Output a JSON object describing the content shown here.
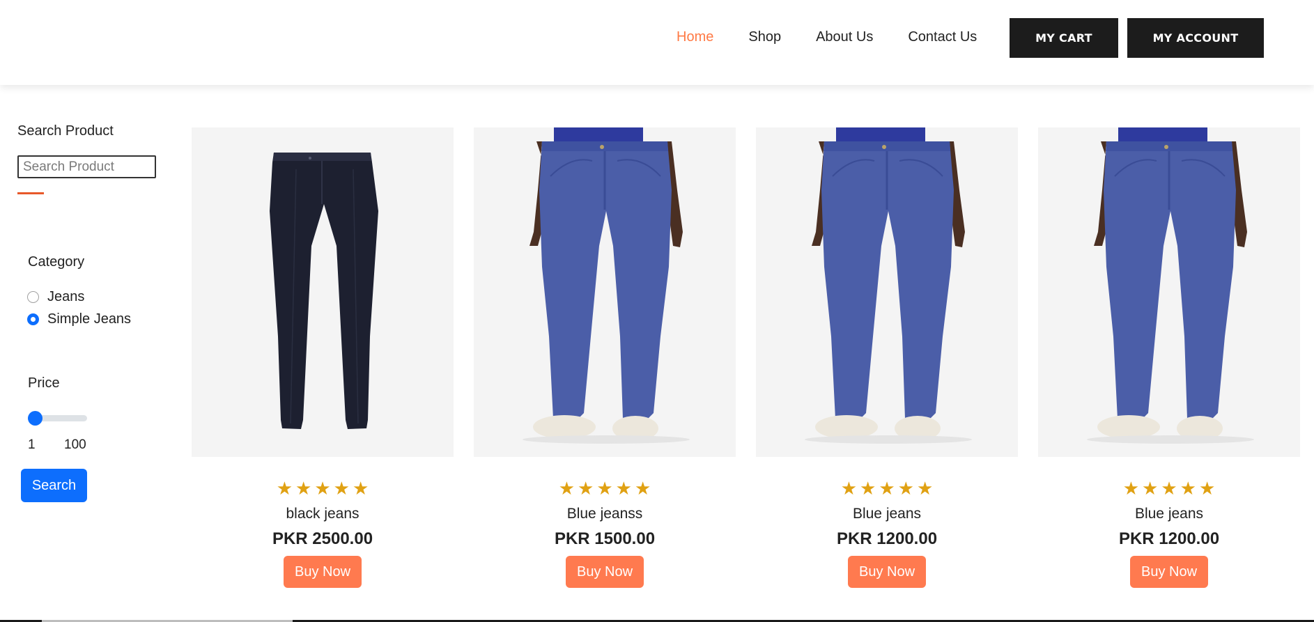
{
  "nav": {
    "items": [
      {
        "label": "Home",
        "active": true
      },
      {
        "label": "Shop",
        "active": false
      },
      {
        "label": "About Us",
        "active": false
      },
      {
        "label": "Contact Us",
        "active": false
      }
    ],
    "cart_label": "MY CART",
    "account_label": "MY ACCOUNT"
  },
  "sidebar": {
    "search_title": "Search Product",
    "search_placeholder": "Search Product",
    "search_value": "",
    "category_title": "Category",
    "categories": [
      {
        "label": "Jeans",
        "checked": false
      },
      {
        "label": "Simple Jeans",
        "checked": true
      }
    ],
    "price_title": "Price",
    "price_min": "1",
    "price_max": "100",
    "price_value_fraction": 0.0,
    "search_button": "Search"
  },
  "products": [
    {
      "name": "black jeans",
      "price": "PKR 2500.00",
      "rating": 5,
      "buy_label": "Buy Now",
      "image": "black-trousers"
    },
    {
      "name": "Blue jeanss",
      "price": "PKR 1500.00",
      "rating": 5,
      "buy_label": "Buy Now",
      "image": "blue-jeans-model"
    },
    {
      "name": "Blue jeans",
      "price": "PKR 1200.00",
      "rating": 5,
      "buy_label": "Buy Now",
      "image": "blue-jeans-model"
    },
    {
      "name": "Blue jeans",
      "price": "PKR 1200.00",
      "rating": 5,
      "buy_label": "Buy Now",
      "image": "blue-jeans-model"
    }
  ],
  "colors": {
    "accent": "#ff7a45",
    "primary": "#0d6efd",
    "star": "#e0a113",
    "buy_button": "#ff7a4f",
    "header_button": "#1c1c1c"
  }
}
